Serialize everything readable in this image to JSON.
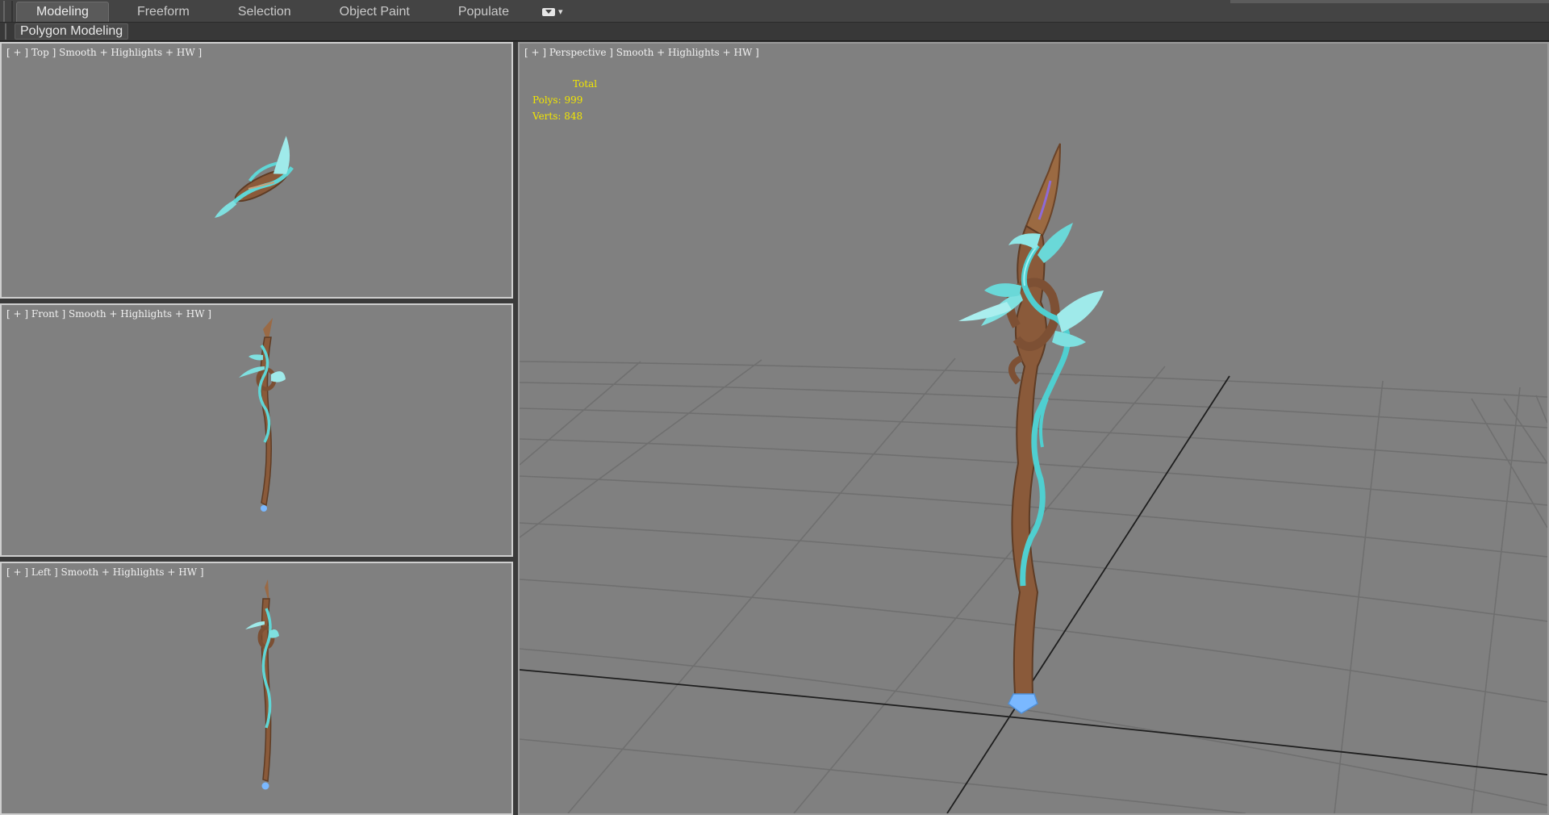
{
  "ribbon": {
    "tabs": [
      {
        "label": "Modeling",
        "active": true
      },
      {
        "label": "Freeform",
        "active": false
      },
      {
        "label": "Selection",
        "active": false
      },
      {
        "label": "Object Paint",
        "active": false
      },
      {
        "label": "Populate",
        "active": false
      }
    ],
    "options_icon": "ribbon-options-icon",
    "panel_label": "Polygon Modeling"
  },
  "viewports": {
    "top": {
      "label": "[ + ] Top ] Smooth + Highlights + HW ]"
    },
    "front": {
      "label": "[ + ] Front ] Smooth + Highlights + HW ]"
    },
    "left": {
      "label": "[ + ] Left ] Smooth + Highlights + HW ]"
    },
    "perspective": {
      "label": "[ + ] Perspective ] Smooth + Highlights + HW ]",
      "stats": {
        "total_label": "Total",
        "polys": "Polys: 999",
        "verts": "Verts: 848"
      }
    }
  },
  "colors": {
    "viewport_bg": "#808080",
    "grid_line": "#6e6e6e",
    "axis_line": "#1e1e1e",
    "stats_text": "#f2e600",
    "wood": "#8a5a3a",
    "vine": "#5fd6d6",
    "crystal": "#7ab8ff"
  }
}
